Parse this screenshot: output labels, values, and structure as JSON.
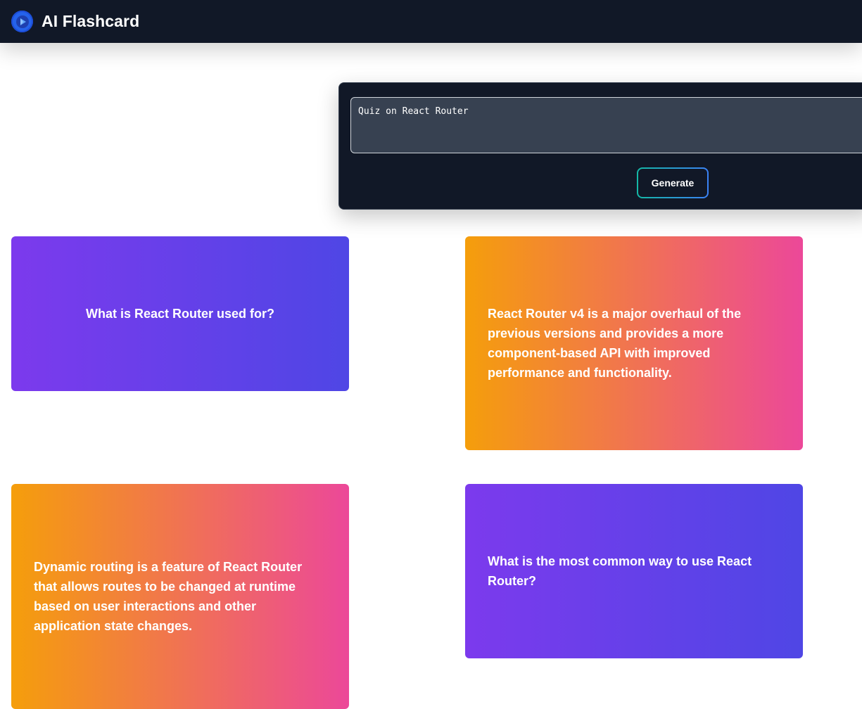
{
  "header": {
    "app_title": "AI Flashcard",
    "logo_icon": "play-logo-icon"
  },
  "generator": {
    "prompt_value": "Quiz on React Router",
    "generate_label": "Generate"
  },
  "cards": [
    {
      "text": "What is React Router used for?",
      "style": "purple"
    },
    {
      "text": "React Router v4 is a major overhaul of the previous versions and provides a more component-based API with improved performance and functionality.",
      "style": "orange"
    },
    {
      "text": "Dynamic routing is a feature of React Router that allows routes to be changed at runtime based on user interactions and other application state changes.",
      "style": "orange"
    },
    {
      "text": "What is the most common way to use React Router?",
      "style": "purple"
    }
  ],
  "colors": {
    "navbar": "#111827",
    "purple_gradient": [
      "#7c3aed",
      "#4f46e5"
    ],
    "orange_gradient": [
      "#f59e0b",
      "#ec4899"
    ],
    "button_border_gradient": [
      "#14b8a6",
      "#3b82f6"
    ]
  }
}
